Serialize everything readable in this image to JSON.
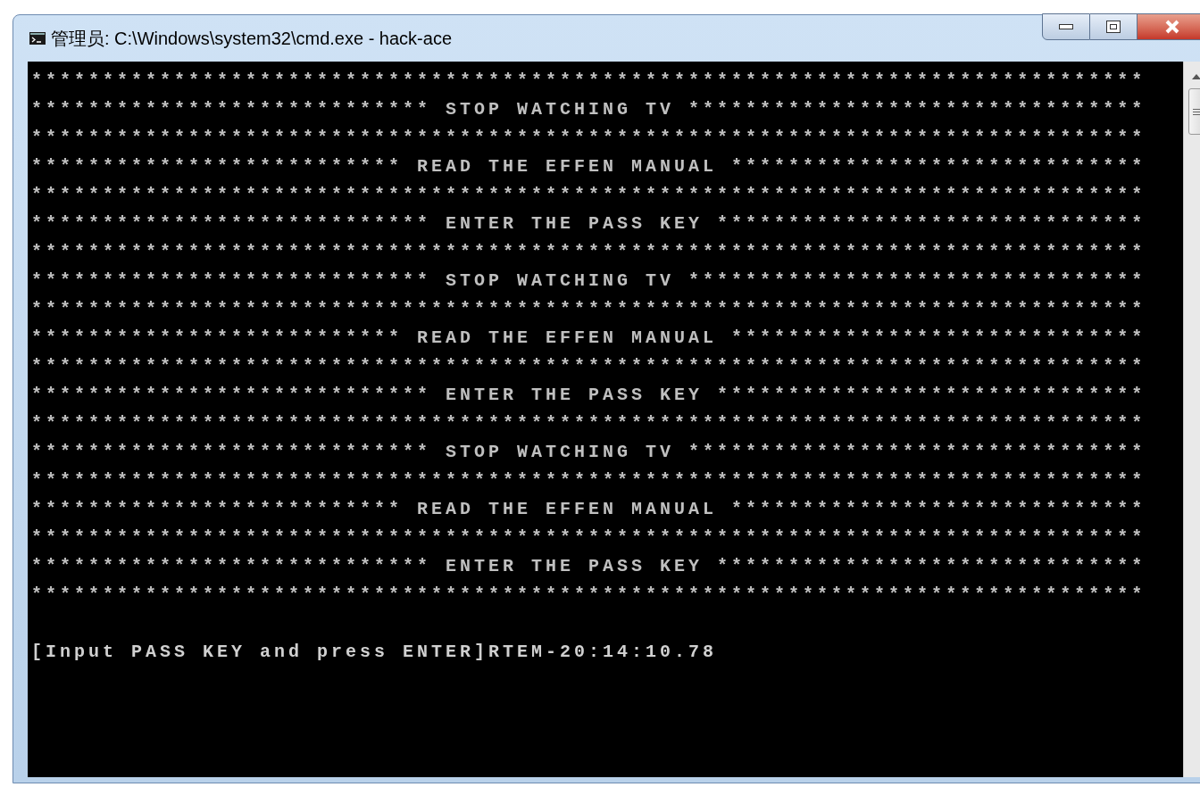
{
  "window": {
    "title": "管理员: C:\\Windows\\system32\\cmd.exe - hack-ace"
  },
  "console": {
    "lines": [
      {
        "kind": "border",
        "text": "******************************************************************************"
      },
      {
        "kind": "banner",
        "text": "**************************** STOP WATCHING TV ********************************"
      },
      {
        "kind": "border",
        "text": "******************************************************************************"
      },
      {
        "kind": "banner",
        "text": "************************** READ THE EFFEN MANUAL *****************************"
      },
      {
        "kind": "border",
        "text": "******************************************************************************"
      },
      {
        "kind": "banner",
        "text": "**************************** ENTER THE PASS KEY ******************************"
      },
      {
        "kind": "border",
        "text": "******************************************************************************"
      },
      {
        "kind": "banner",
        "text": "**************************** STOP WATCHING TV ********************************"
      },
      {
        "kind": "border",
        "text": "******************************************************************************"
      },
      {
        "kind": "banner",
        "text": "************************** READ THE EFFEN MANUAL *****************************"
      },
      {
        "kind": "border",
        "text": "******************************************************************************"
      },
      {
        "kind": "banner",
        "text": "**************************** ENTER THE PASS KEY ******************************"
      },
      {
        "kind": "border",
        "text": "******************************************************************************"
      },
      {
        "kind": "banner",
        "text": "**************************** STOP WATCHING TV ********************************"
      },
      {
        "kind": "border",
        "text": "******************************************************************************"
      },
      {
        "kind": "banner",
        "text": "************************** READ THE EFFEN MANUAL *****************************"
      },
      {
        "kind": "border",
        "text": "******************************************************************************"
      },
      {
        "kind": "banner",
        "text": "**************************** ENTER THE PASS KEY ******************************"
      },
      {
        "kind": "border",
        "text": "******************************************************************************"
      },
      {
        "kind": "blank"
      },
      {
        "kind": "prompt",
        "text": "[Input PASS KEY and press ENTER]RTEM-20:14:10.78"
      }
    ]
  }
}
